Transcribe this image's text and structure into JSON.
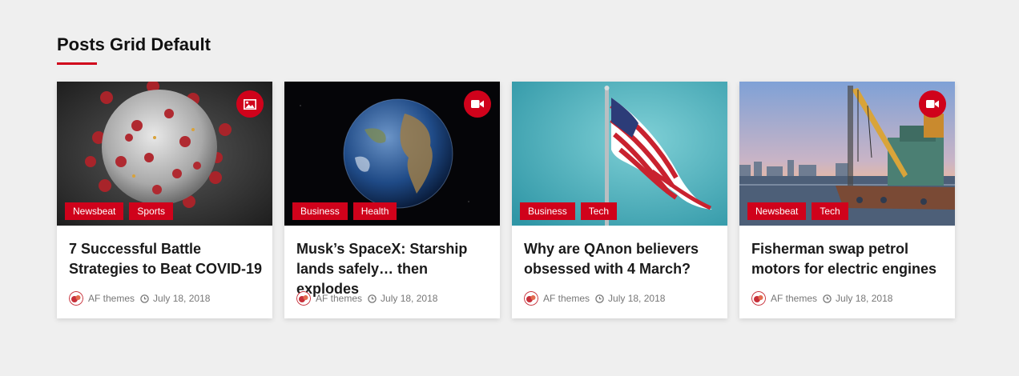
{
  "section": {
    "title": "Posts Grid Default"
  },
  "colors": {
    "accent": "#d0021b",
    "background": "#efefef",
    "card": "#ffffff"
  },
  "posts": [
    {
      "image": "coronavirus-illustration",
      "format_icon": "image-icon",
      "categories": [
        "Newsbeat",
        "Sports"
      ],
      "title": "7 Successful Battle Strategies to Beat COVID-19",
      "author": "AF themes",
      "date": "July 18, 2018"
    },
    {
      "image": "planet-earth-from-space",
      "format_icon": "video-icon",
      "categories": [
        "Business",
        "Health"
      ],
      "title": "Musk’s SpaceX: Starship lands safely… then explodes",
      "author": "AF themes",
      "date": "July 18, 2018"
    },
    {
      "image": "american-flag-on-pole",
      "format_icon": "",
      "categories": [
        "Business",
        "Tech"
      ],
      "title": "Why are QAnon believers obsessed with 4 March?",
      "author": "AF themes",
      "date": "July 18, 2018"
    },
    {
      "image": "industrial-crane-barge",
      "format_icon": "video-icon",
      "categories": [
        "Newsbeat",
        "Tech"
      ],
      "title": "Fisherman swap petrol motors for electric engines",
      "author": "AF themes",
      "date": "July 18, 2018"
    }
  ]
}
